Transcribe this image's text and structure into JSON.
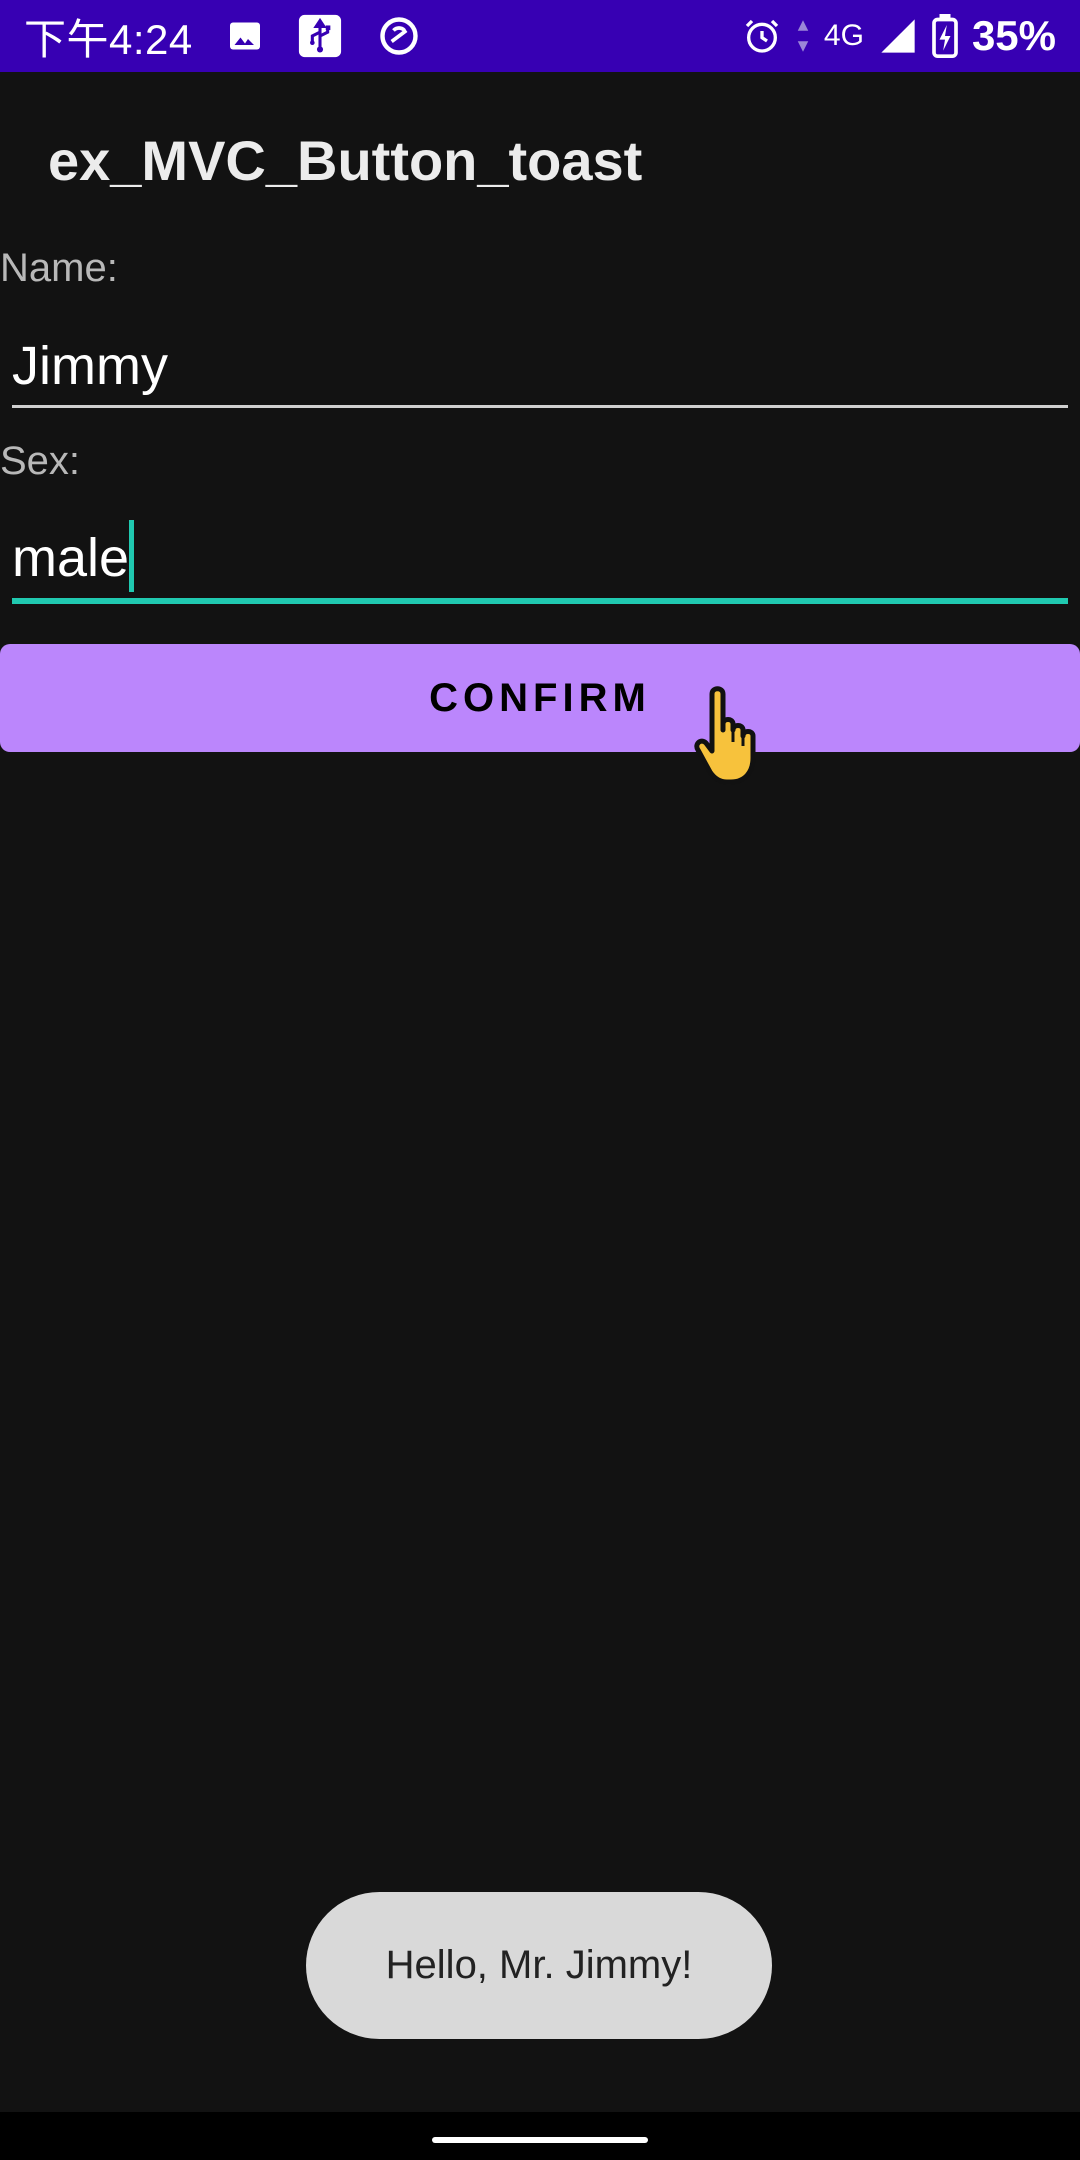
{
  "status_bar": {
    "time": "下午4:24",
    "network": "4G",
    "battery": "35%",
    "icons": [
      "image-icon",
      "usb-icon",
      "vpn-icon",
      "alarm-icon",
      "data-activity-icon",
      "signal-icon",
      "battery-charging-icon"
    ]
  },
  "app": {
    "title": "ex_MVC_Button_toast"
  },
  "form": {
    "name_label": "Name:",
    "name_value": "Jimmy",
    "sex_label": "Sex:",
    "sex_value": "male"
  },
  "button": {
    "confirm_label": "CONFIRM"
  },
  "toast": {
    "message": "Hello, Mr. Jimmy!"
  },
  "colors": {
    "status_bar": "#3700b3",
    "background": "#121212",
    "button": "#bb86fc",
    "accent": "#20c9b0",
    "toast": "#d9d9d9"
  }
}
